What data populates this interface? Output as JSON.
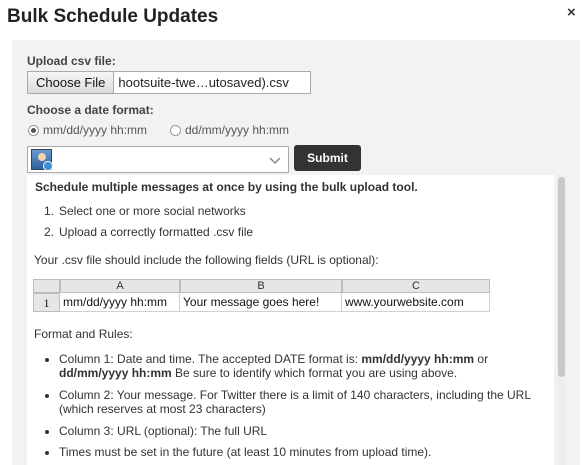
{
  "dialog": {
    "title": "Bulk Schedule Updates",
    "close_glyph": "×"
  },
  "upload": {
    "label": "Upload csv file:",
    "choose_button": "Choose File",
    "file_name": "hootsuite-twe…utosaved).csv"
  },
  "date_format": {
    "label": "Choose a date format:",
    "options": [
      {
        "label": "mm/dd/yyyy hh:mm",
        "selected": true
      },
      {
        "label": "dd/mm/yyyy hh:mm",
        "selected": false
      }
    ]
  },
  "profile_select": {
    "avatar_icon": "profile-avatar-icon",
    "chevron_icon": "chevron-down-icon"
  },
  "submit_label": "Submit",
  "info": {
    "heading": "Schedule multiple messages at once by using the bulk upload tool.",
    "steps": [
      "Select one or more social networks",
      "Upload a correctly formatted .csv file"
    ],
    "fields_intro": "Your .csv file should include the following fields (URL is optional):",
    "sheet": {
      "columns": [
        "A",
        "B",
        "C"
      ],
      "row_number": "1",
      "cells": [
        "mm/dd/yyyy hh:mm",
        "Your message goes here!",
        "www.yourwebsite.com"
      ]
    },
    "format_heading": "Format and Rules:",
    "rules": {
      "r1_a": "Column 1: Date and time. The accepted DATE format is: ",
      "r1_b": "mm/dd/yyyy hh:mm",
      "r1_c": " or",
      "r1_d": "dd/mm/yyyy hh:mm",
      "r1_e": " Be sure to identify which format you are using above.",
      "r2_a": "Column 2: Your message. For Twitter there is a limit of 140 characters, including the URL",
      "r2_b": "(which reserves at most 23 characters)",
      "r3": "Column 3: URL (optional): The full URL",
      "r4": "Times must be set in the future (at least 10 minutes from upload time)."
    }
  }
}
